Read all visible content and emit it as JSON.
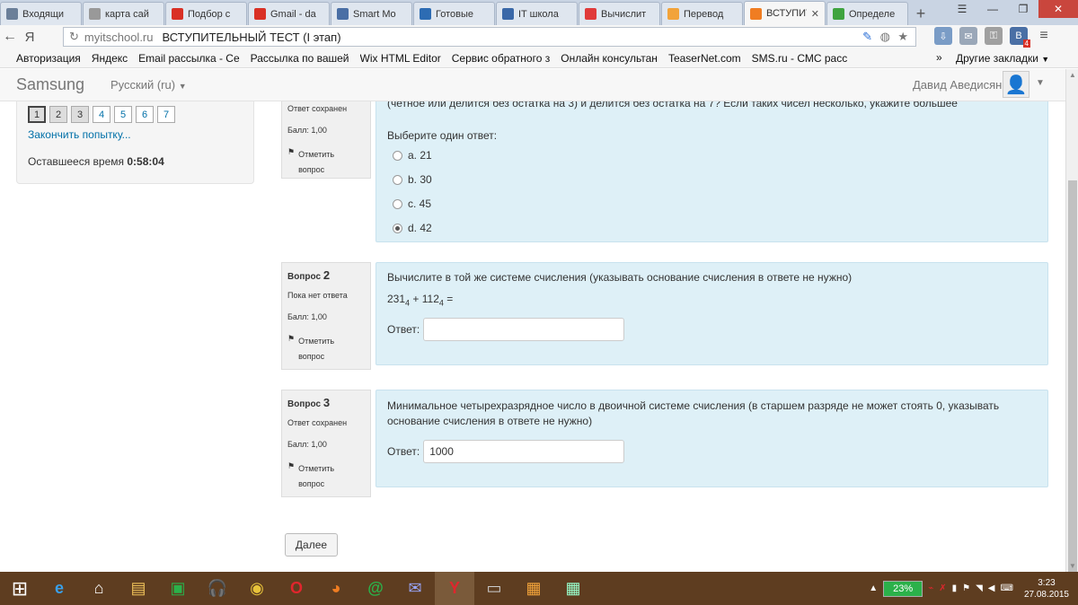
{
  "browser": {
    "tabs": [
      {
        "label": "Входящи",
        "icon": "mail-icon",
        "color": "#6b7f99"
      },
      {
        "label": "карта сай",
        "icon": "page-icon",
        "color": "#999999"
      },
      {
        "label": "Подбор с",
        "icon": "chart-icon",
        "color": "#d93025"
      },
      {
        "label": "Gmail - da",
        "icon": "gmail-icon",
        "color": "#d93025"
      },
      {
        "label": "Smart Mo",
        "icon": "b-icon",
        "color": "#4a6fa5"
      },
      {
        "label": "Готовые",
        "icon": "ng-icon",
        "color": "#2d6cb3"
      },
      {
        "label": "IT школа",
        "icon": "s-icon",
        "color": "#3a68a8"
      },
      {
        "label": "Вычислит",
        "icon": "yandex-icon",
        "color": "#e03a3a"
      },
      {
        "label": "Перевод",
        "icon": "translate-icon",
        "color": "#f2a33a"
      },
      {
        "label": "ВСТУПИТЕ",
        "icon": "moodle-icon",
        "color": "#f07d22",
        "active": true
      },
      {
        "label": "Определе",
        "icon": "book-icon",
        "color": "#3fa33f"
      }
    ],
    "url_host": "myitschool.ru",
    "url_title": "ВСТУПИТЕЛЬНЫЙ ТЕСТ (I этап)",
    "yandex_logo": "Я",
    "bookmarks": [
      "Авторизация",
      "Яндекс",
      "Email рассылка - Се",
      "Рассылка по вашей",
      "Wix HTML Editor",
      "Сервис обратного з",
      "Онлайн консультан",
      "TeaserNet.com",
      "SMS.ru - СМС расс"
    ],
    "bookmarks_more": "»",
    "other_bookmarks": "Другие закладки",
    "ext_badge": "4"
  },
  "site": {
    "brand": "Samsung",
    "language": "Русский (ru)",
    "user_name": "Давид Аведисян"
  },
  "quiz_nav": {
    "buttons": [
      "1",
      "2",
      "3",
      "4",
      "5",
      "6",
      "7"
    ],
    "finish_link": "Закончить попытку...",
    "time_label": "Оставшееся время",
    "time_value": "0:58:04"
  },
  "q1": {
    "status": "Ответ сохранен",
    "score": "Балл: 1,00",
    "flag": "Отметить вопрос",
    "text_tail": "(четное или делится без остатка на 3) и делится без остатка на 7? Если таких чисел несколько, укажите большее",
    "prompt": "Выберите один ответ:",
    "options": [
      "a. 21",
      "b. 30",
      "c. 45",
      "d. 42"
    ],
    "selected_index": 3
  },
  "q2": {
    "label": "Вопрос",
    "number": "2",
    "status": "Пока нет ответа",
    "score": "Балл: 1,00",
    "flag": "Отметить вопрос",
    "text": "Вычислите в той же системе счисления  (указывать основание счисления в ответе не нужно)",
    "formula_a": "231",
    "formula_a_base": "4",
    "formula_op": " + ",
    "formula_b": "112",
    "formula_b_base": "4",
    "formula_eq": " =",
    "answer_label": "Ответ:",
    "answer_value": ""
  },
  "q3": {
    "label": "Вопрос",
    "number": "3",
    "status": "Ответ сохранен",
    "score": "Балл: 1,00",
    "flag": "Отметить вопрос",
    "text": "Минимальное четырехразрядное число в двоичной системе счисления (в старшем разряде не может стоять 0, указывать основание счисления в ответе не нужно)",
    "answer_label": "Ответ:",
    "answer_value": "1000"
  },
  "next_button": "Далее",
  "taskbar": {
    "battery": "23%",
    "time": "3:23",
    "date": "27.08.2015"
  }
}
